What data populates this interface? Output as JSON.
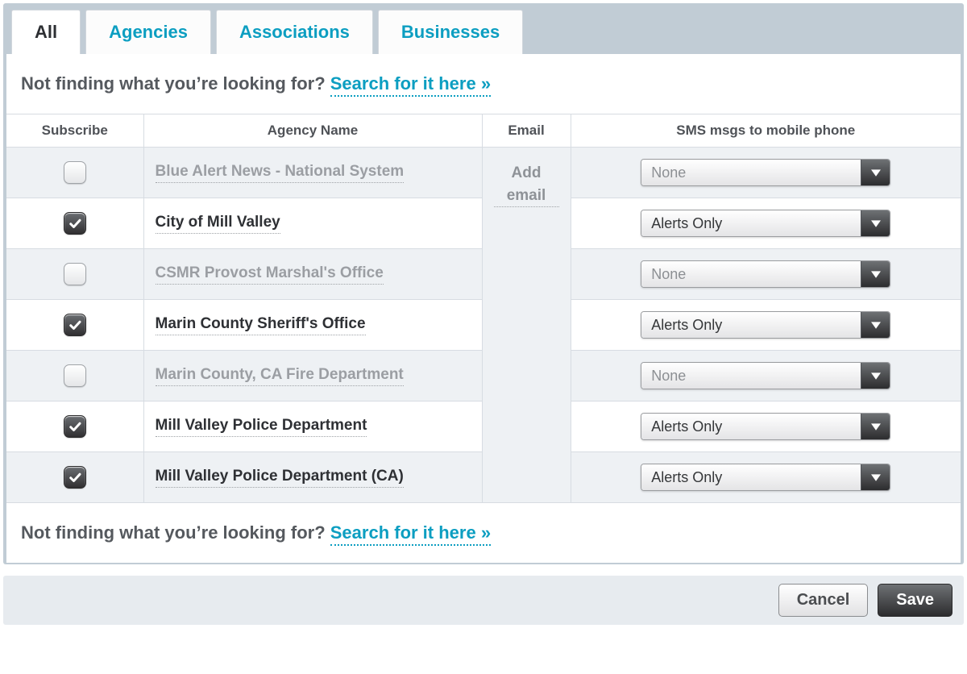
{
  "tabs": [
    {
      "label": "All",
      "active": true
    },
    {
      "label": "Agencies",
      "active": false
    },
    {
      "label": "Associations",
      "active": false
    },
    {
      "label": "Businesses",
      "active": false
    }
  ],
  "search_prompt": {
    "text": "Not finding what you’re looking for? ",
    "link": "Search for it here »"
  },
  "columns": {
    "subscribe": "Subscribe",
    "agency": "Agency Name",
    "email": "Email",
    "sms": "SMS msgs to mobile phone"
  },
  "email_action": "Add email",
  "rows": [
    {
      "subscribed": false,
      "name": "Blue Alert News - National System",
      "sms": "None"
    },
    {
      "subscribed": true,
      "name": "City of Mill Valley",
      "sms": "Alerts Only"
    },
    {
      "subscribed": false,
      "name": "CSMR Provost Marshal's Office",
      "sms": "None"
    },
    {
      "subscribed": true,
      "name": "Marin County Sheriff's Office",
      "sms": "Alerts Only"
    },
    {
      "subscribed": false,
      "name": "Marin County, CA Fire Department",
      "sms": "None"
    },
    {
      "subscribed": true,
      "name": "Mill Valley Police Department",
      "sms": "Alerts Only"
    },
    {
      "subscribed": true,
      "name": "Mill Valley Police Department (CA)",
      "sms": "Alerts Only"
    }
  ],
  "buttons": {
    "cancel": "Cancel",
    "save": "Save"
  }
}
